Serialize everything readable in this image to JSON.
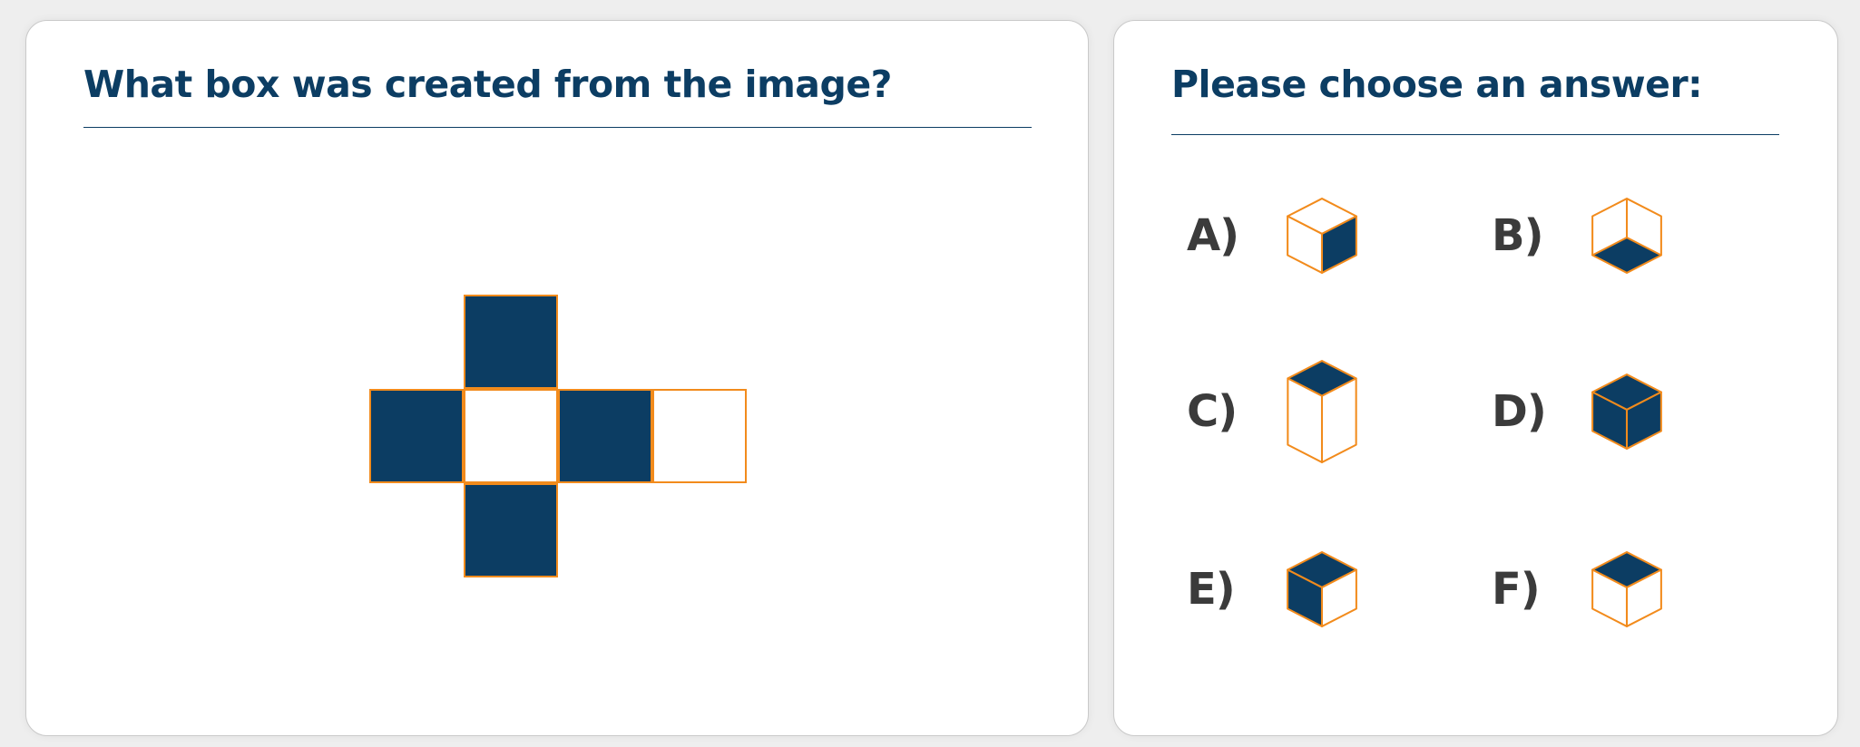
{
  "question": {
    "title": "What box was created from the image?",
    "net": {
      "cells": [
        {
          "id": "top",
          "filled": true
        },
        {
          "id": "left",
          "filled": true
        },
        {
          "id": "center",
          "filled": false
        },
        {
          "id": "right",
          "filled": true
        },
        {
          "id": "far-right",
          "filled": false
        },
        {
          "id": "bottom",
          "filled": true
        }
      ]
    }
  },
  "answers": {
    "title": "Please choose an answer:",
    "options": [
      {
        "label": "A)",
        "cube": "right-face-filled"
      },
      {
        "label": "B)",
        "cube": "bottom-face-filled"
      },
      {
        "label": "C)",
        "cube": "top-face-filled-tall"
      },
      {
        "label": "D)",
        "cube": "all-faces-filled"
      },
      {
        "label": "E)",
        "cube": "top-and-left-filled"
      },
      {
        "label": "F)",
        "cube": "top-face-filled"
      }
    ]
  },
  "colors": {
    "navy": "#0c3d63",
    "orange": "#f28b1c",
    "label": "#3b3b3b",
    "background": "#eeeeee",
    "panel": "#ffffff"
  }
}
